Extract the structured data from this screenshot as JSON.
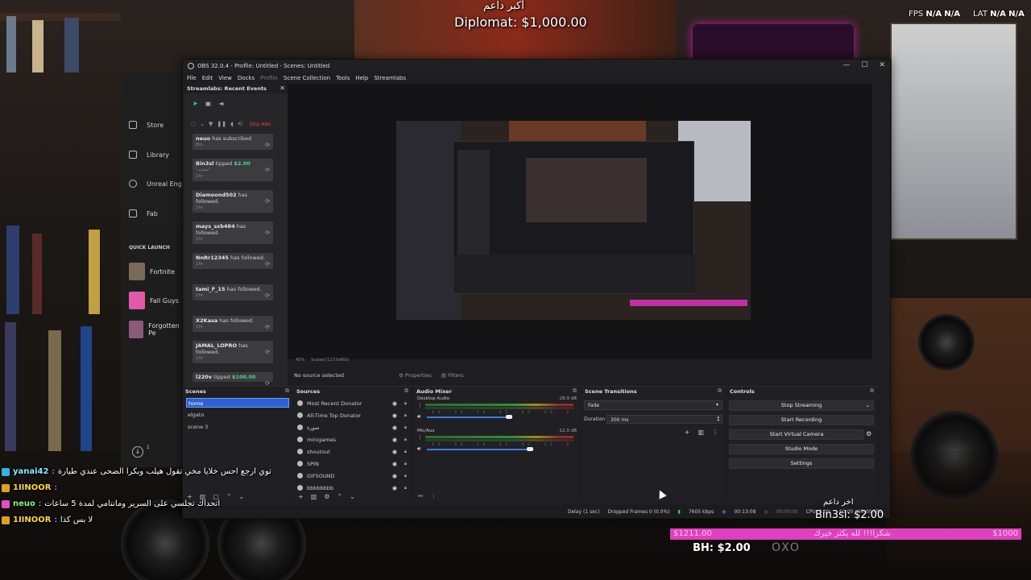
{
  "overlay": {
    "donor_label": "أكبر داعم",
    "donor_amount": "Diplomat: $1,000.00",
    "fps_label": "FPS",
    "fps_value1": "N/A",
    "fps_value2": "N/A",
    "lat_label": "LAT",
    "lat_value1": "N/A",
    "lat_value2": "N/A",
    "latest_label": "اخر داعم",
    "latest_amount": "Bin3sl: $2.00",
    "goal_left": "$1211.00",
    "goal_middle": "شكرا!!! لله يكثر خيرك",
    "goal_right": "$1000",
    "goal_fraction": 1.0,
    "goal_bottom": "BH: $2.00",
    "goal_logo": "OXO"
  },
  "launcher": {
    "items": [
      {
        "label": "Store",
        "icon": "tag-icon"
      },
      {
        "label": "Library",
        "icon": "grid-icon"
      },
      {
        "label": "Unreal Eng",
        "icon": "unreal-icon"
      },
      {
        "label": "Fab",
        "icon": "fab-icon"
      }
    ],
    "quick_launch": "QUICK LAUNCH",
    "games": [
      {
        "label": "Fortnite",
        "color": "#7a6a58"
      },
      {
        "label": "Fall Guys",
        "color": "#e05aa8"
      },
      {
        "label": "Forgotten Pe",
        "color": "#8a5a7a"
      }
    ],
    "download_count": "1"
  },
  "obs": {
    "title": "OBS 32.0.4 - Profile: Untitled - Scenes: Untitled",
    "menu": [
      "File",
      "Edit",
      "View",
      "Docks",
      "Profile",
      "Scene Collection",
      "Tools",
      "Help",
      "Streamlabs"
    ],
    "events": {
      "title": "Streamlabs: Recent Events",
      "skip_label": "Skip Aler",
      "items": [
        {
          "name": "neuo",
          "text": " has subscribed",
          "amount": "",
          "note": "",
          "time": "8m"
        },
        {
          "name": "Bin3sl",
          "text": " tipped ",
          "amount": "$2.00",
          "note": "\"تستت\"",
          "time": "1hr"
        },
        {
          "name": "Diamoond502",
          "text": " has followed.",
          "amount": "",
          "note": "",
          "time": "1hr"
        },
        {
          "name": "mays_sxb484",
          "text": " has followed.",
          "amount": "",
          "note": "",
          "time": "1hr"
        },
        {
          "name": "NnRr12345",
          "text": " has followed.",
          "amount": "",
          "note": "",
          "time": "1hr"
        },
        {
          "name": "tami_F_15",
          "text": " has followed.",
          "amount": "",
          "note": "",
          "time": "1hr"
        },
        {
          "name": "X2Kasa",
          "text": " has followed.",
          "amount": "",
          "note": "",
          "time": "1hr"
        },
        {
          "name": "JAMAL_LOPRO",
          "text": " has followed.",
          "amount": "",
          "note": "",
          "time": "1hr"
        },
        {
          "name": "l220v",
          "text": " tipped ",
          "amount": "$100.00",
          "note": "",
          "time": ""
        }
      ]
    },
    "preview_status": {
      "zoom": "45%",
      "scaled": "Scaled (1173x660)"
    },
    "no_source": "No source selected",
    "properties_label": "Properties",
    "filters_label": "Filters",
    "scenes": {
      "title": "Scenes",
      "items": [
        "home",
        "elgato",
        "scene 3"
      ],
      "selected": "home"
    },
    "sources": {
      "title": "Sources",
      "items": [
        "Most Recent Donator",
        "All-Time Top Donator",
        "صورة",
        "minigames",
        "shoutout",
        "SPIN",
        "GIFSOUND",
        "bbbbbbbb"
      ]
    },
    "mixer": {
      "title": "Audio Mixer",
      "channels": [
        {
          "name": "Desktop Audio",
          "db": "-28.9 dB",
          "level": 0.6
        },
        {
          "name": "Mic/Aux",
          "db": "-12.0 dB",
          "level": 0.75
        }
      ],
      "scale": "-60 -55 -50 -45 -40 -35 -30 -25 -20 -15 -10 -5 0"
    },
    "transitions": {
      "title": "Scene Transitions",
      "selected": "Fade",
      "duration_label": "Duration",
      "duration_value": "300 ms"
    },
    "controls": {
      "title": "Controls",
      "buttons": [
        "Stop Streaming",
        "Start Recording",
        "Start Virtual Camera",
        "Studio Mode",
        "Settings"
      ]
    },
    "status": {
      "delay": "Delay (1 sec)",
      "dropped": "Dropped Frames 0 (0.0%)",
      "bitrate": "7605 kbps",
      "stream_time": "00:13:08",
      "rec_time": "00:00:00",
      "cpu": "CPU: 2.0%",
      "fps": "60.00 / 60.00 FPS"
    }
  },
  "chat": [
    {
      "user": "yanai42",
      "message": "توي ارجع احس خلايا مخي تقول هيلب وبكرا الضحى عندي طيارة",
      "color": "user1"
    },
    {
      "user": "1IINOOR",
      "message": "",
      "color": "user2"
    },
    {
      "user": "neuo",
      "message": "اتحداك تجلسي على السرير ومانتامي لمدة 5 ساعات",
      "color": "user3"
    },
    {
      "user": "1IINOOR",
      "message": "لا بس كذا",
      "color": "user2"
    }
  ]
}
